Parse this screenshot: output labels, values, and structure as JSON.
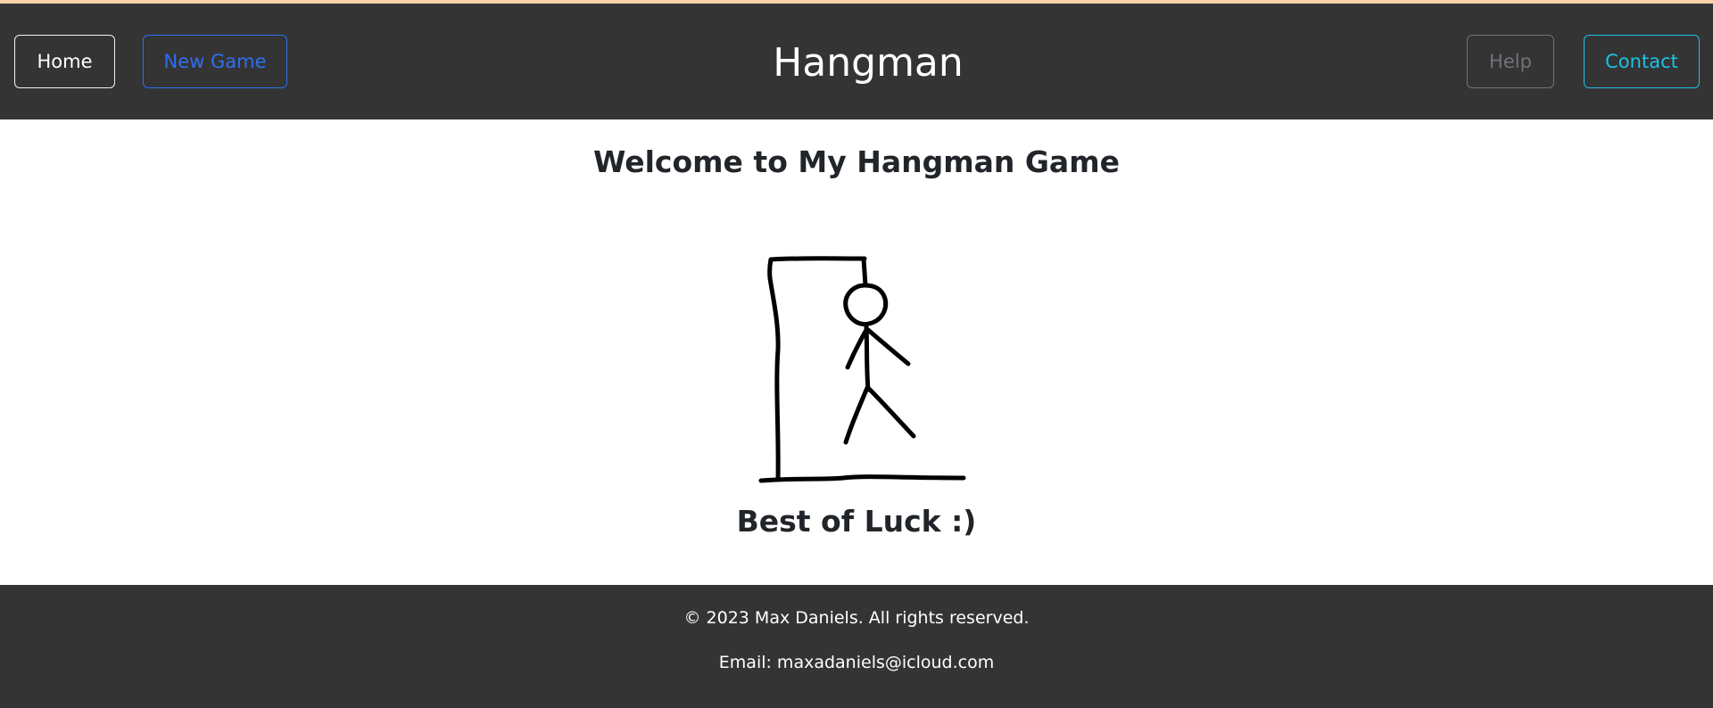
{
  "header": {
    "title": "Hangman",
    "nav": {
      "home_label": "Home",
      "new_game_label": "New Game",
      "help_label": "Help",
      "contact_label": "Contact"
    }
  },
  "main": {
    "welcome_heading": "Welcome to My Hangman Game",
    "luck_text": "Best of Luck :)",
    "image": "hangman-stick-figure"
  },
  "footer": {
    "copyright": "© 2023 Max Daniels. All rights reserved.",
    "email": "Email: maxadaniels@icloud.com"
  },
  "colors": {
    "header_bg": "#343434",
    "accent_top": "#fbd2a9",
    "new_game": "#2f6ff0",
    "help": "#6f737a",
    "contact": "#1cc2e4"
  }
}
